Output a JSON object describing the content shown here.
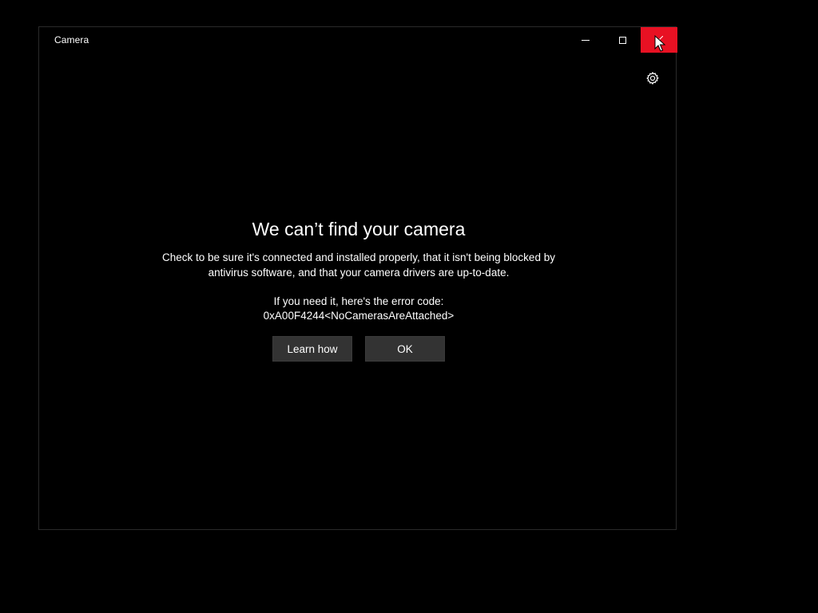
{
  "window": {
    "title": "Camera",
    "caption_buttons": {
      "minimize_icon": "minimize-icon",
      "maximize_icon": "maximize-icon",
      "close_icon": "close-icon",
      "close_hover_color": "#e81123"
    },
    "settings_icon": "gear-icon"
  },
  "error": {
    "heading": "We can’t find your camera",
    "description": "Check to be sure it's connected and installed properly, that it isn't being blocked by antivirus software, and that your camera drivers are up-to-date.",
    "code_intro": "If you need it, here's the error code:",
    "code": "0xA00F4244<NoCamerasAreAttached>"
  },
  "actions": {
    "learn_how_label": "Learn how",
    "ok_label": "OK"
  }
}
